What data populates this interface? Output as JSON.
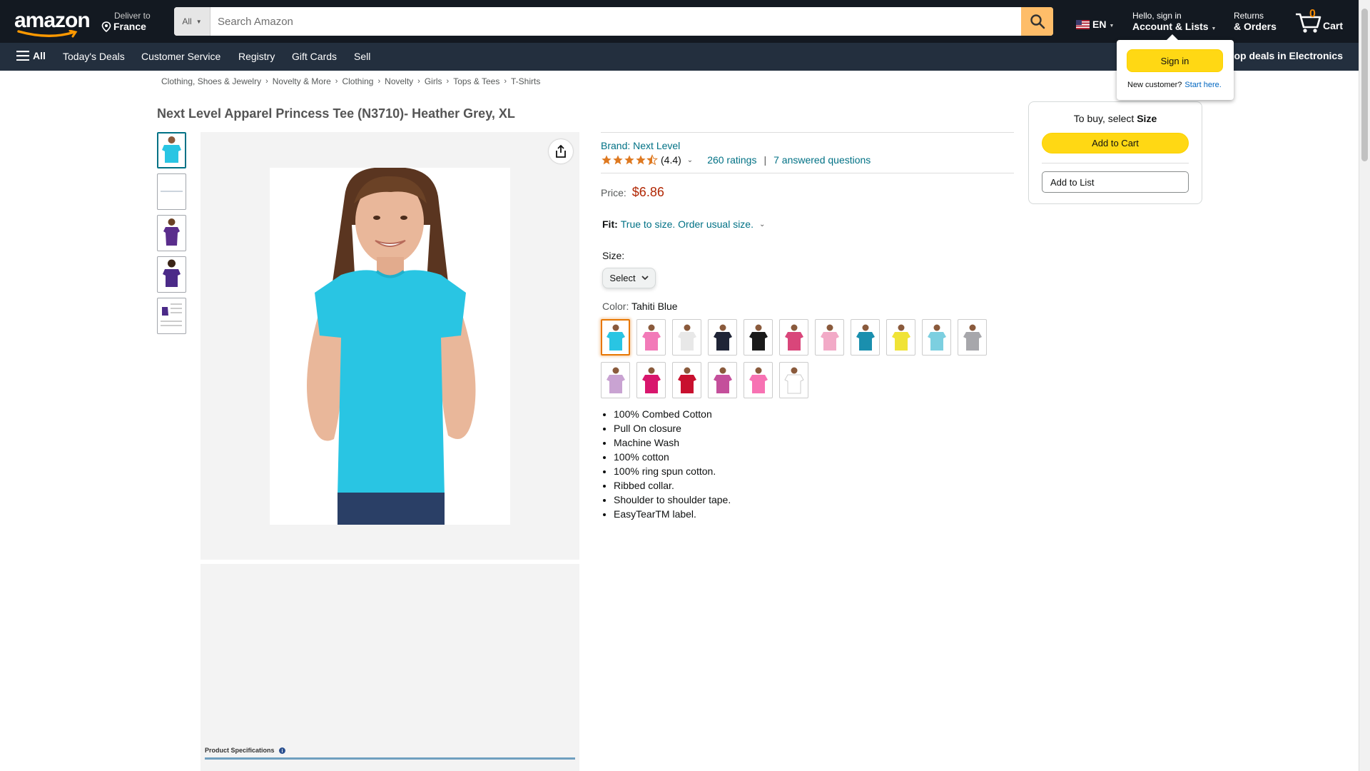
{
  "header": {
    "deliver_line1": "Deliver to",
    "deliver_line2": "France",
    "search_category": "All",
    "search_placeholder": "Search Amazon",
    "language": "EN",
    "account_line1": "Hello, sign in",
    "account_line2": "Account & Lists",
    "returns_line1": "Returns",
    "returns_line2": "& Orders",
    "cart_count": "0",
    "cart_label": "Cart"
  },
  "subnav": {
    "all_label": "All",
    "links": [
      "Today's Deals",
      "Customer Service",
      "Registry",
      "Gift Cards",
      "Sell"
    ],
    "promo": "op deals in Electronics"
  },
  "breadcrumb": [
    "Clothing, Shoes & Jewelry",
    "Novelty & More",
    "Clothing",
    "Novelty",
    "Girls",
    "Tops & Tees",
    "T-Shirts"
  ],
  "product": {
    "title": "Next Level Apparel Princess Tee (N3710)- Heather Grey, XL",
    "brand": "Brand: Next Level",
    "rating": "(4.4)",
    "rating_value": 4.4,
    "ratings_count": "260 ratings",
    "questions": "7 answered questions",
    "price_label": "Price:",
    "price": "$6.86",
    "fit_label": "Fit:",
    "fit_value": "True to size. Order usual size.",
    "size_label": "Size:",
    "size_select": "Select",
    "color_label": "Color:",
    "color_value": "Tahiti Blue",
    "spec_caption": "Product Specifications",
    "bullets": [
      "100% Combed Cotton",
      "Pull On closure",
      "Machine Wash",
      "100% cotton",
      "100% ring spun cotton.",
      "Ribbed collar.",
      "Shoulder to shoulder tape.",
      "EasyTearTM label."
    ]
  },
  "swatch_colors": [
    "#29c5e3",
    "#f27ab8",
    "#e8e8e8",
    "#1f2436",
    "#1a1a1a",
    "#d9467a",
    "#f2aac7",
    "#1a8fae",
    "#f0e336",
    "#7ccfe0",
    "#a7a7ab",
    "#c9a3d2",
    "#d8166d",
    "#c8102e",
    "#c44f9b",
    "#f772b3",
    "#ffffff"
  ],
  "thumb_colors": [
    "#29c5e3",
    "#ffffff",
    "#5a2d8c",
    "#4b2a88",
    "#ffffff"
  ],
  "buybox": {
    "to_buy_prefix": "To buy, select",
    "to_buy_bold": "Size",
    "add_to_cart": "Add to Cart",
    "add_to_list": "Add to List"
  },
  "popover": {
    "signin": "Sign in",
    "new_customer": "New customer?",
    "start_here": "Start here."
  },
  "colors": {
    "nav_dark": "#131921",
    "nav_sub": "#232f3e",
    "accent_yellow": "#ffd814",
    "search_btn": "#febd69",
    "link": "#007185",
    "price_red": "#b12704",
    "cart_orange": "#f08804"
  }
}
